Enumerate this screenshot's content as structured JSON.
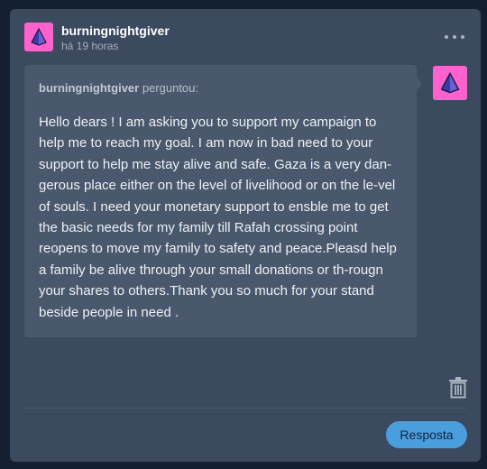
{
  "post": {
    "username": "burningnightgiver",
    "timestamp": "há 19 horas",
    "more_icon": "ellipsis-icon"
  },
  "ask": {
    "asker_name": "burningnightgiver",
    "asked_label": "perguntou:",
    "text": "Hello dears ! I am asking you to support my campaign to help me to reach my goal. I am now in bad need to your support to help me stay alive and safe. Gaza is a very dan-gerous place either on the level of livelihood or on the le-vel of souls. I need your monetary support to ensble me to get the basic needs for my family till Rafah crossing point reopens to move my family to safety and peace.Pleasd help a family be alive through your small donations or th-rougn your shares to others.Thank you so much for your stand beside people in need ."
  },
  "actions": {
    "delete_icon": "trash-icon",
    "reply_label": "Resposta"
  },
  "colors": {
    "card_background": "#3b4a5f",
    "bubble_background": "#4a586d",
    "avatar_background": "#ff62ce",
    "reply_button": "#4b9ede"
  }
}
